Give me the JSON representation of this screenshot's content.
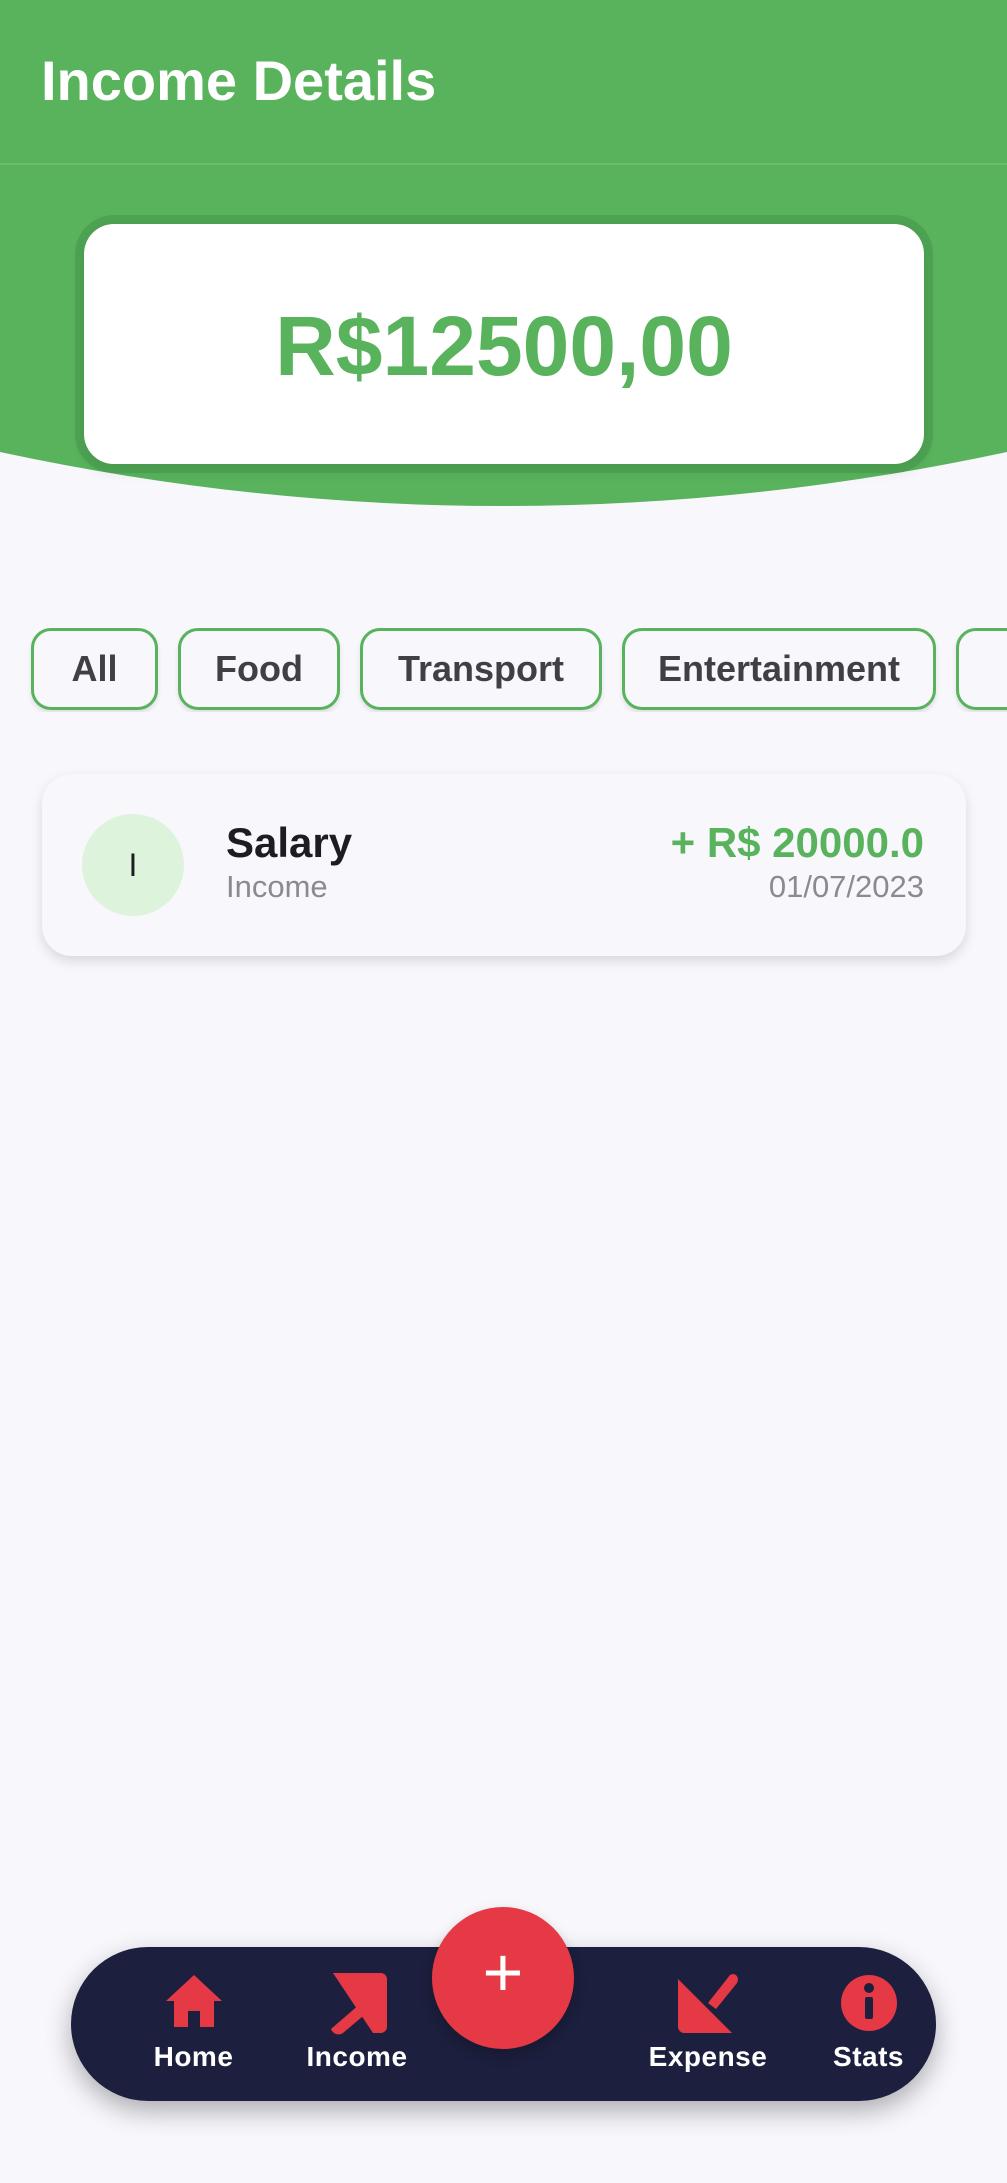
{
  "header": {
    "title": "Income Details"
  },
  "balance": {
    "amount": "R$12500,00"
  },
  "filters": {
    "chips": [
      {
        "label": "All"
      },
      {
        "label": "Food"
      },
      {
        "label": "Transport"
      },
      {
        "label": "Entertainment"
      },
      {
        "label": ""
      }
    ]
  },
  "transactions": [
    {
      "avatar_letter": "I",
      "title": "Salary",
      "category": "Income",
      "amount": "+ R$ 20000.0",
      "date": "01/07/2023"
    }
  ],
  "bottom_nav": {
    "items": [
      {
        "label": "Home",
        "icon": "home-icon"
      },
      {
        "label": "Income",
        "icon": "arrow-up-right-icon"
      },
      {
        "label": "Expense",
        "icon": "arrow-down-left-icon"
      },
      {
        "label": "Stats",
        "icon": "info-icon"
      }
    ],
    "fab_symbol": "+",
    "fab_icon": "plus-icon"
  },
  "colors": {
    "primary_green": "#58b35c",
    "accent_red": "#e63946",
    "nav_background": "#1c1f3d",
    "page_background": "#f7f7fc",
    "avatar_background": "#ddf3dc"
  }
}
